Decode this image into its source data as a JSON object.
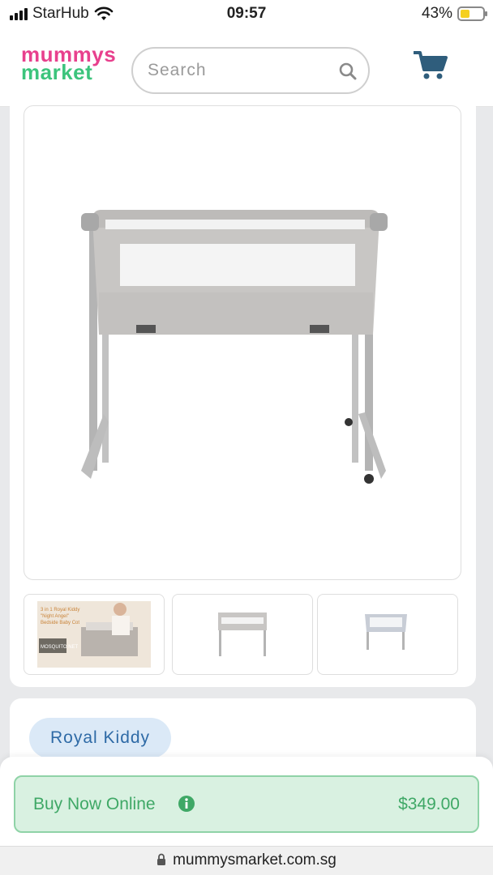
{
  "status_bar": {
    "carrier": "StarHub",
    "time": "09:57",
    "battery": "43%",
    "battery_level": 0.43
  },
  "header": {
    "logo_line1": "mummys",
    "logo_line2": "market",
    "search": {
      "placeholder": "Search",
      "value": ""
    }
  },
  "gallery": {
    "thumbnails": [
      {
        "caption_lines": [
          "3 in 1 Royal Kiddy",
          "\"Night Angel\"",
          "Bedside Baby Cot"
        ],
        "badge": "MOSQUITO NET"
      },
      {
        "icon": "crib-front-view"
      },
      {
        "icon": "crib-side-view"
      }
    ]
  },
  "brand": {
    "label": "Royal Kiddy"
  },
  "buy": {
    "label": "Buy Now Online",
    "price": "$349.00"
  },
  "url": "mummysmarket.com.sg",
  "colors": {
    "brand_pink": "#e8408d",
    "brand_green": "#3cc47c",
    "buy_green": "#3fa866",
    "pill_blue": "#2e6aa6"
  }
}
